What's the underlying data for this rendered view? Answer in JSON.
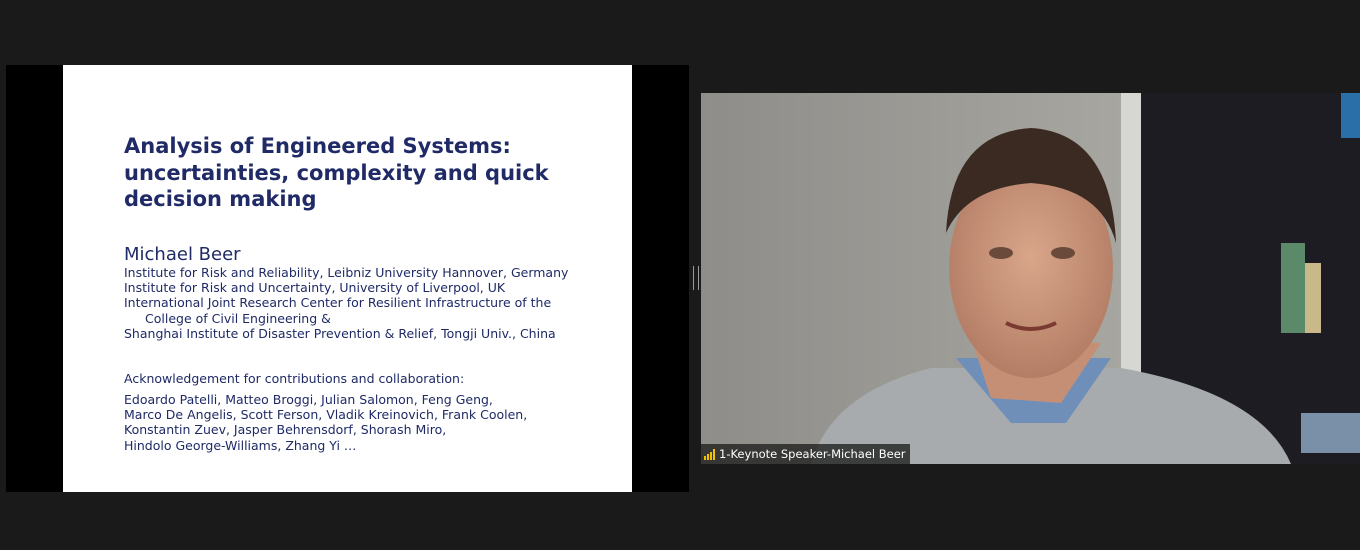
{
  "slide": {
    "title_lines": [
      "Analysis of Engineered Systems:",
      "uncertainties, complexity and quick",
      "decision making"
    ],
    "author": "Michael Beer",
    "affiliations": [
      "Institute for Risk and Reliability, Leibniz University Hannover, Germany",
      "Institute for Risk and Uncertainty, University of Liverpool, UK",
      "International Joint Research Center for Resilient Infrastructure of the",
      "College of Civil Engineering &",
      "Shanghai Institute of Disaster Prevention & Relief, Tongji Univ., China"
    ],
    "acknowledgement_heading": "Acknowledgement for contributions and collaboration:",
    "acknowledgement_names": [
      "Edoardo Patelli, Matteo Broggi, Julian Salomon, Feng Geng,",
      "Marco De Angelis, Scott Ferson, Vladik Kreinovich, Frank Coolen,",
      "Konstantin Zuev, Jasper Behrensdorf, Shorash Miro,",
      "Hindolo George-Williams, Zhang Yi …"
    ]
  },
  "video": {
    "participant_name": "1-Keynote Speaker-Michael Beer",
    "signal_icon": "signal-strength-icon"
  },
  "colors": {
    "background": "#1a1a1a",
    "slide_text": "#1f2a66",
    "signal": "#f2c200"
  }
}
